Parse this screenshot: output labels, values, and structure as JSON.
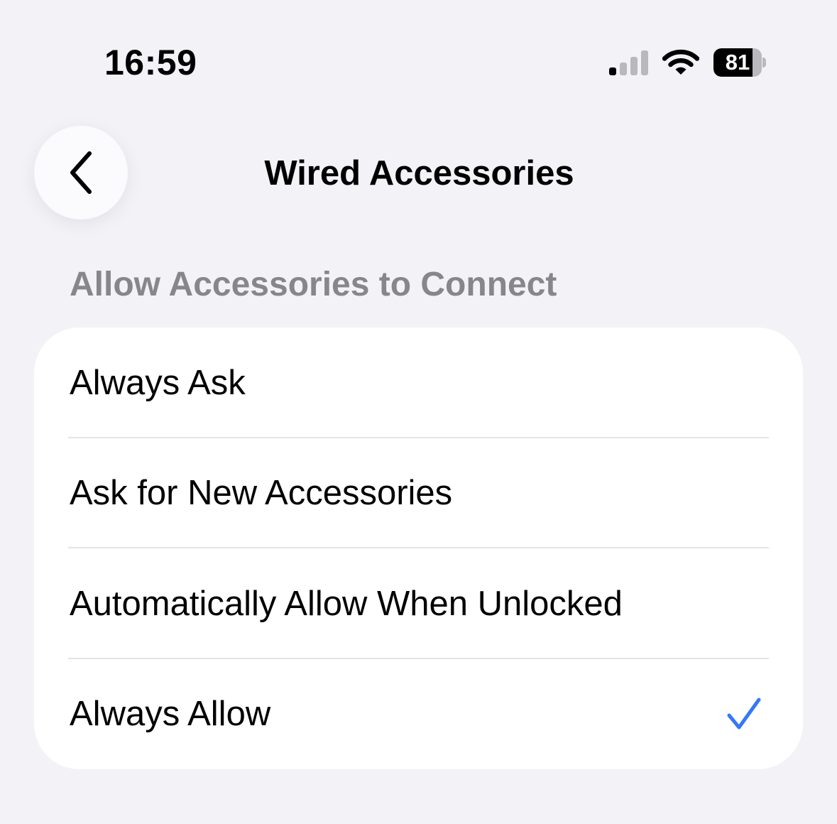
{
  "status_bar": {
    "time": "16:59",
    "signal_icon": "cellular-signal-icon",
    "signal_bars_active": 1,
    "signal_bars_total": 4,
    "wifi_icon": "wifi-icon",
    "battery_level": "81",
    "battery_fraction": 0.81
  },
  "nav": {
    "back_icon": "chevron-left-icon",
    "title": "Wired Accessories"
  },
  "section": {
    "header": "Allow Accessories to Connect",
    "options": [
      {
        "label": "Always Ask",
        "selected": false
      },
      {
        "label": "Ask for New Accessories",
        "selected": false
      },
      {
        "label": "Automatically Allow When Unlocked",
        "selected": false
      },
      {
        "label": "Always Allow",
        "selected": true
      }
    ]
  },
  "colors": {
    "background": "#f2f2f7",
    "card": "#ffffff",
    "accent": "#3478f6",
    "secondary_text": "#86868b"
  }
}
